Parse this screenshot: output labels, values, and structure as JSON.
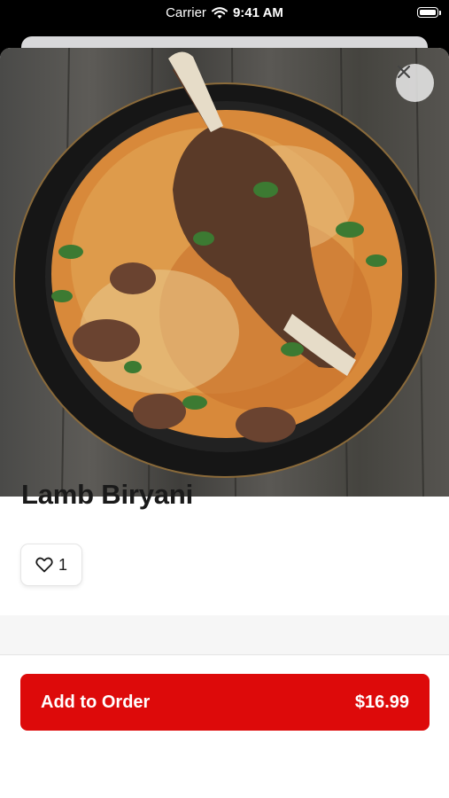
{
  "status_bar": {
    "carrier": "Carrier",
    "time": "9:41 AM"
  },
  "item": {
    "name": "Lamb Biryani",
    "image_icon": "food-photo",
    "like_count": "1"
  },
  "actions": {
    "add_label": "Add to Order",
    "price": "$16.99"
  },
  "colors": {
    "accent": "#dd0a0a"
  }
}
